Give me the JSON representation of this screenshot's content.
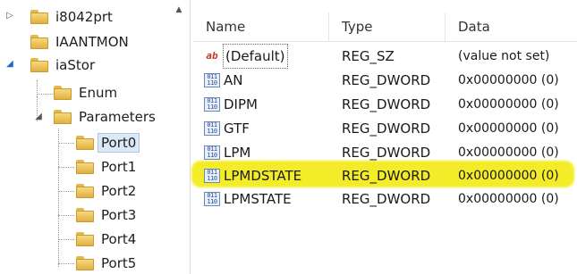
{
  "tree": {
    "items": [
      {
        "label": "i8042prt"
      },
      {
        "label": "IAANTMON"
      },
      {
        "label": "iaStor"
      },
      {
        "label": "Enum"
      },
      {
        "label": "Parameters"
      },
      {
        "label": "Port0"
      },
      {
        "label": "Port1"
      },
      {
        "label": "Port2"
      },
      {
        "label": "Port3"
      },
      {
        "label": "Port4"
      },
      {
        "label": "Port5"
      }
    ],
    "selected": "Port0"
  },
  "list": {
    "columns": {
      "name": "Name",
      "type": "Type",
      "data": "Data"
    },
    "rows": [
      {
        "name": "(Default)",
        "type": "REG_SZ",
        "data": "(value not set)",
        "icon": "string-value-icon"
      },
      {
        "name": "AN",
        "type": "REG_DWORD",
        "data": "0x00000000 (0)",
        "icon": "binary-value-icon"
      },
      {
        "name": "DIPM",
        "type": "REG_DWORD",
        "data": "0x00000000 (0)",
        "icon": "binary-value-icon"
      },
      {
        "name": "GTF",
        "type": "REG_DWORD",
        "data": "0x00000000 (0)",
        "icon": "binary-value-icon"
      },
      {
        "name": "LPM",
        "type": "REG_DWORD",
        "data": "0x00000000 (0)",
        "icon": "binary-value-icon"
      },
      {
        "name": "LPMDSTATE",
        "type": "REG_DWORD",
        "data": "0x00000000 (0)",
        "icon": "binary-value-icon"
      },
      {
        "name": "LPMSTATE",
        "type": "REG_DWORD",
        "data": "0x00000000 (0)",
        "icon": "binary-value-icon"
      }
    ],
    "highlighted_row": "LPMDSTATE"
  },
  "colors": {
    "highlight": "#f4ec1e",
    "folder": "#f0c95c",
    "selection": "#dce8f5"
  }
}
